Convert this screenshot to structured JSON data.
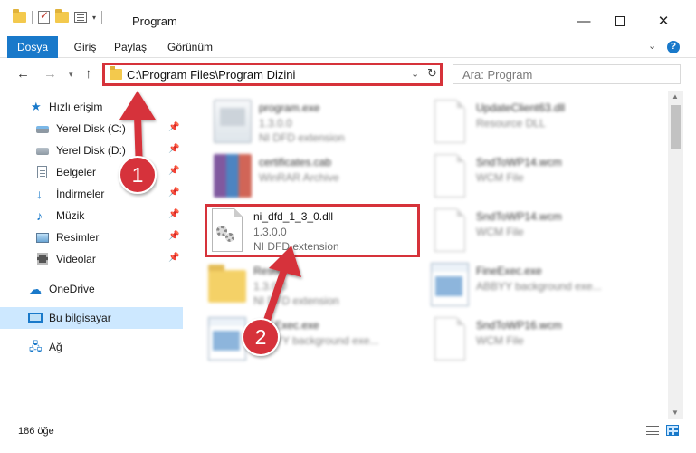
{
  "window": {
    "title": "Program"
  },
  "ribbon": {
    "tabs": [
      {
        "label": "Dosya"
      },
      {
        "label": "Giriş"
      },
      {
        "label": "Paylaş"
      },
      {
        "label": "Görünüm"
      }
    ],
    "help": "?"
  },
  "address": {
    "path": "C:\\Program Files\\Program Dizini",
    "search_placeholder": "Ara: Program"
  },
  "sidebar": {
    "items": [
      {
        "label": "Hızlı erişim",
        "icon": "star-icon"
      },
      {
        "label": "Yerel Disk (C:)",
        "icon": "drive-icon",
        "pinned": true
      },
      {
        "label": "Yerel Disk (D:)",
        "icon": "drive-icon",
        "pinned": true
      },
      {
        "label": "Belgeler",
        "icon": "documents-icon",
        "pinned": true
      },
      {
        "label": "İndirmeler",
        "icon": "downloads-icon",
        "pinned": true
      },
      {
        "label": "Müzik",
        "icon": "music-icon",
        "pinned": true
      },
      {
        "label": "Resimler",
        "icon": "pictures-icon",
        "pinned": true
      },
      {
        "label": "Videolar",
        "icon": "videos-icon",
        "pinned": true
      },
      {
        "label": "OneDrive",
        "icon": "cloud-icon"
      },
      {
        "label": "Bu bilgisayar",
        "icon": "computer-icon",
        "selected": true
      },
      {
        "label": "Ağ",
        "icon": "network-icon"
      }
    ]
  },
  "files": [
    {
      "name": "program.exe",
      "line1": "1.3.0.0",
      "line2": "NI DFD extension",
      "icon": "exe-icon"
    },
    {
      "name": "UpdateClient63.dll",
      "line1": "Resource DLL",
      "line2": "",
      "icon": "dll-icon"
    },
    {
      "name": "certificates.cab",
      "line1": "WinRAR Archive",
      "line2": "",
      "icon": "archive-icon"
    },
    {
      "name": "SndToWP14.wcm",
      "line1": "WCM File",
      "line2": "",
      "icon": "file-icon"
    },
    {
      "name": "ni_dfd_1_3_0.dll",
      "line1": "1.3.0.0",
      "line2": "NI DFD extension",
      "icon": "dll-gear-icon"
    },
    {
      "name": "SndToWP14.wcm",
      "line1": "WCM File",
      "line2": "",
      "icon": "file-icon"
    },
    {
      "name": "Resource",
      "line1": "1.3.0.0",
      "line2": "NI DFD extension",
      "icon": "folder-icon"
    },
    {
      "name": "FineExec.exe",
      "line1": "ABBYY background exe...",
      "line2": "",
      "icon": "app-window-icon"
    },
    {
      "name": "FineExec.exe",
      "line1": "ABBYY background exe...",
      "line2": "",
      "icon": "app-window-icon"
    },
    {
      "name": "SndToWP16.wcm",
      "line1": "WCM File",
      "line2": "",
      "icon": "file-icon"
    }
  ],
  "annotations": {
    "step1": "1",
    "step2": "2",
    "color": "#d6323a"
  },
  "status": {
    "count": "186 öğe"
  }
}
